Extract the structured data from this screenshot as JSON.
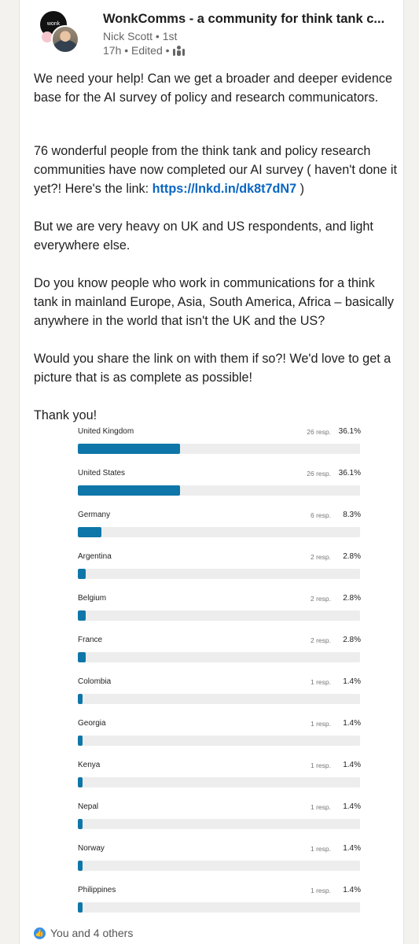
{
  "post": {
    "group_name": "WonkComms - a community for think tank c...",
    "group_logo_text": "wonk",
    "author": "Nick Scott • 1st",
    "meta": "17h • Edited •",
    "visibility_icon": "group-members-icon",
    "paragraphs": {
      "p1": "We need your help! Can we get a broader and deeper evidence base for the AI survey of policy and research communicators.",
      "p2_pre": "76 wonderful people from the think tank and policy research communities have now completed our AI survey ( haven't done it yet?! Here's the link: ",
      "p2_link": "https://lnkd.in/dk8t7dN7",
      "p2_post": " )",
      "p3": "But we are very heavy on UK and US respondents, and light everywhere else.",
      "p4": "Do you know people who work in communications for a think tank in mainland Europe, Asia, South America, Africa – basically anywhere in the world that isn't the UK and the US?",
      "p5": "Would you share the link on with them if so?! We'd love to get a picture that is as complete as possible!",
      "p6": "Thank you!"
    },
    "reactions": {
      "icon": "like-icon",
      "text": "You and 4 others"
    }
  },
  "colors": {
    "bar_fill": "#0e76a8",
    "bar_track": "#ededed",
    "link": "#0a66c2"
  },
  "chart_data": {
    "type": "bar",
    "orientation": "horizontal",
    "categories": [
      "United Kingdom",
      "United States",
      "Germany",
      "Argentina",
      "Belgium",
      "France",
      "Colombia",
      "Georgia",
      "Kenya",
      "Nepal",
      "Norway",
      "Philippines"
    ],
    "responses_text": [
      "26 resp.",
      "26 resp.",
      "6 resp.",
      "2 resp.",
      "2 resp.",
      "2 resp.",
      "1 resp.",
      "1 resp.",
      "1 resp.",
      "1 resp.",
      "1 resp.",
      "1 resp."
    ],
    "percent_text": [
      "36.1%",
      "36.1%",
      "8.3%",
      "2.8%",
      "2.8%",
      "2.8%",
      "1.4%",
      "1.4%",
      "1.4%",
      "1.4%",
      "1.4%",
      "1.4%"
    ],
    "values": [
      36.1,
      36.1,
      8.3,
      2.8,
      2.8,
      2.8,
      1.4,
      1.4,
      1.4,
      1.4,
      1.4,
      1.4
    ],
    "xlim": [
      0,
      100
    ]
  }
}
